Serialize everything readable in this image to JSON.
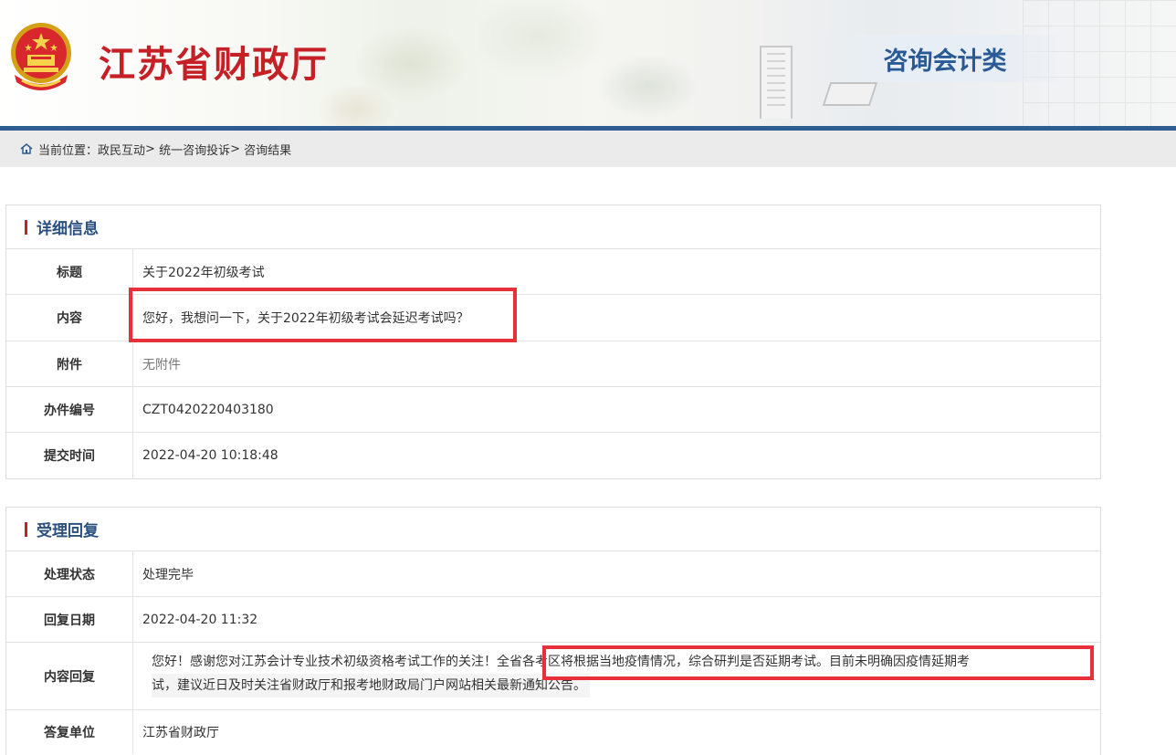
{
  "header": {
    "site_title": "江苏省财政厅",
    "section_tab": "咨询会计类"
  },
  "breadcrumb": {
    "prefix": "当前位置：",
    "items": [
      "政民互动",
      "统一咨询投诉",
      "咨询结果"
    ],
    "separator": ">"
  },
  "detail": {
    "heading": "详细信息",
    "rows": [
      {
        "label": "标题",
        "value": "关于2022年初级考试"
      },
      {
        "label": "内容",
        "value": "您好，我想问一下，关于2022年初级考试会延迟考试吗？"
      },
      {
        "label": "附件",
        "value": "无附件"
      },
      {
        "label": "办件编号",
        "value": "CZT0420220403180"
      },
      {
        "label": "提交时间",
        "value": "2022-04-20 10:18:48"
      }
    ]
  },
  "reply": {
    "heading": "受理回复",
    "rows": [
      {
        "label": "处理状态",
        "value": "处理完毕"
      },
      {
        "label": "回复日期",
        "value": "2022-04-20 11:32"
      },
      {
        "label": "内容回复",
        "value_part1": "您好！感谢您对江苏会计专业技术初级资格考试工作的关注！",
        "value_part2": "全省各考区将根据当地疫情情况，综合研判是否延期考试。目前未明确因疫情延期考",
        "value_part3": "试，建议近日及时关注省财政厅和报考地财政局门户网站相关最新通知公告。"
      },
      {
        "label": "答复单位",
        "value": "江苏省财政厅"
      }
    ]
  },
  "colors": {
    "brand_red": "#c62027",
    "brand_blue": "#2e5d91",
    "highlight_red": "#e8303a"
  }
}
